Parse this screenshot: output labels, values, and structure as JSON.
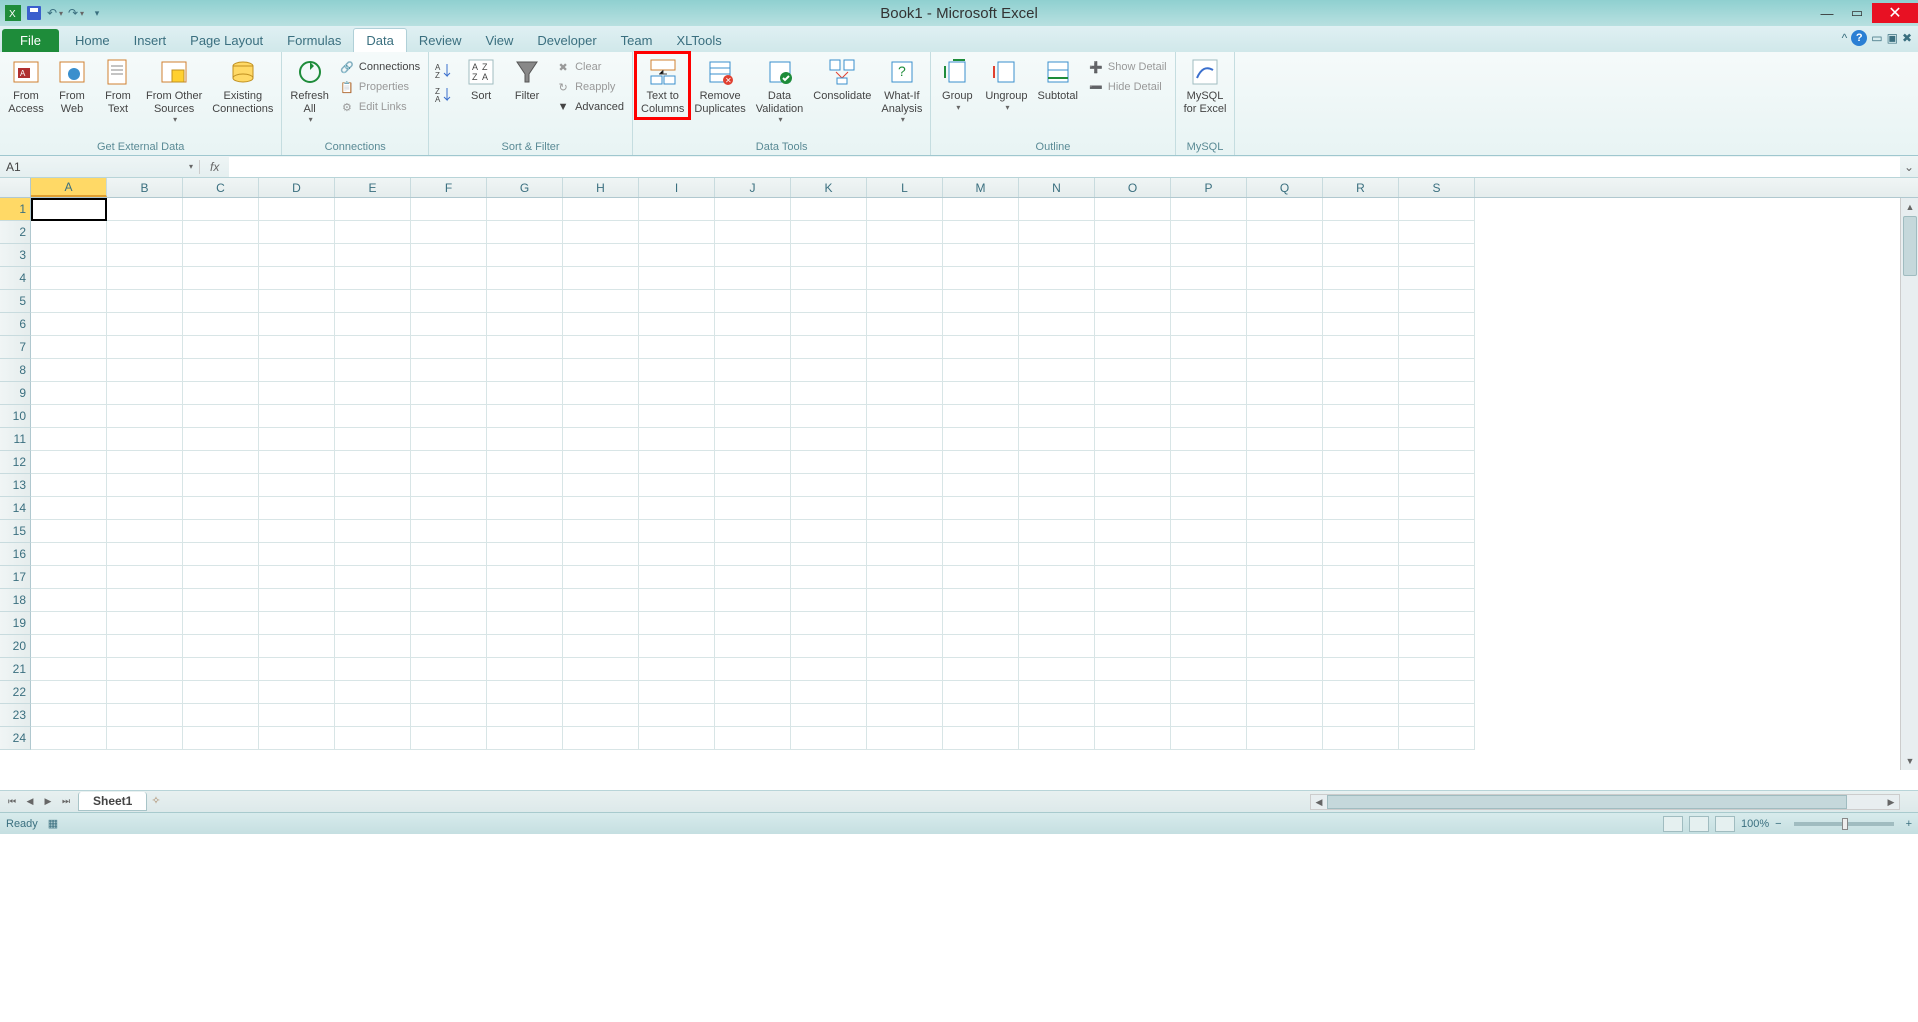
{
  "title": "Book1 - Microsoft Excel",
  "qat": {
    "undo_tip": "Undo",
    "redo_tip": "Redo",
    "save_tip": "Save"
  },
  "tabs": {
    "file": "File",
    "items": [
      "Home",
      "Insert",
      "Page Layout",
      "Formulas",
      "Data",
      "Review",
      "View",
      "Developer",
      "Team",
      "XLTools"
    ],
    "active": "Data"
  },
  "ribbon": {
    "get_external": {
      "label": "Get External Data",
      "from_access": "From\nAccess",
      "from_web": "From\nWeb",
      "from_text": "From\nText",
      "from_other": "From Other\nSources",
      "existing": "Existing\nConnections"
    },
    "connections": {
      "label": "Connections",
      "refresh": "Refresh\nAll",
      "conn": "Connections",
      "props": "Properties",
      "edit_links": "Edit Links"
    },
    "sort_filter": {
      "label": "Sort & Filter",
      "sort": "Sort",
      "filter": "Filter",
      "clear": "Clear",
      "reapply": "Reapply",
      "advanced": "Advanced"
    },
    "data_tools": {
      "label": "Data Tools",
      "text_to_cols": "Text to\nColumns",
      "remove_dup": "Remove\nDuplicates",
      "validation": "Data\nValidation",
      "consolidate": "Consolidate",
      "whatif": "What-If\nAnalysis"
    },
    "outline": {
      "label": "Outline",
      "group": "Group",
      "ungroup": "Ungroup",
      "subtotal": "Subtotal",
      "show_detail": "Show Detail",
      "hide_detail": "Hide Detail"
    },
    "mysql": {
      "label": "MySQL",
      "btn": "MySQL\nfor Excel"
    }
  },
  "namebox": {
    "value": "A1"
  },
  "formula": {
    "value": ""
  },
  "columns": [
    "A",
    "B",
    "C",
    "D",
    "E",
    "F",
    "G",
    "H",
    "I",
    "J",
    "K",
    "L",
    "M",
    "N",
    "O",
    "P",
    "Q",
    "R",
    "S"
  ],
  "rows": [
    1,
    2,
    3,
    4,
    5,
    6,
    7,
    8,
    9,
    10,
    11,
    12,
    13,
    14,
    15,
    16,
    17,
    18,
    19,
    20,
    21,
    22,
    23,
    24
  ],
  "active_cell": "A1",
  "sheets": {
    "active": "Sheet1"
  },
  "status": {
    "ready": "Ready",
    "zoom": "100%"
  }
}
